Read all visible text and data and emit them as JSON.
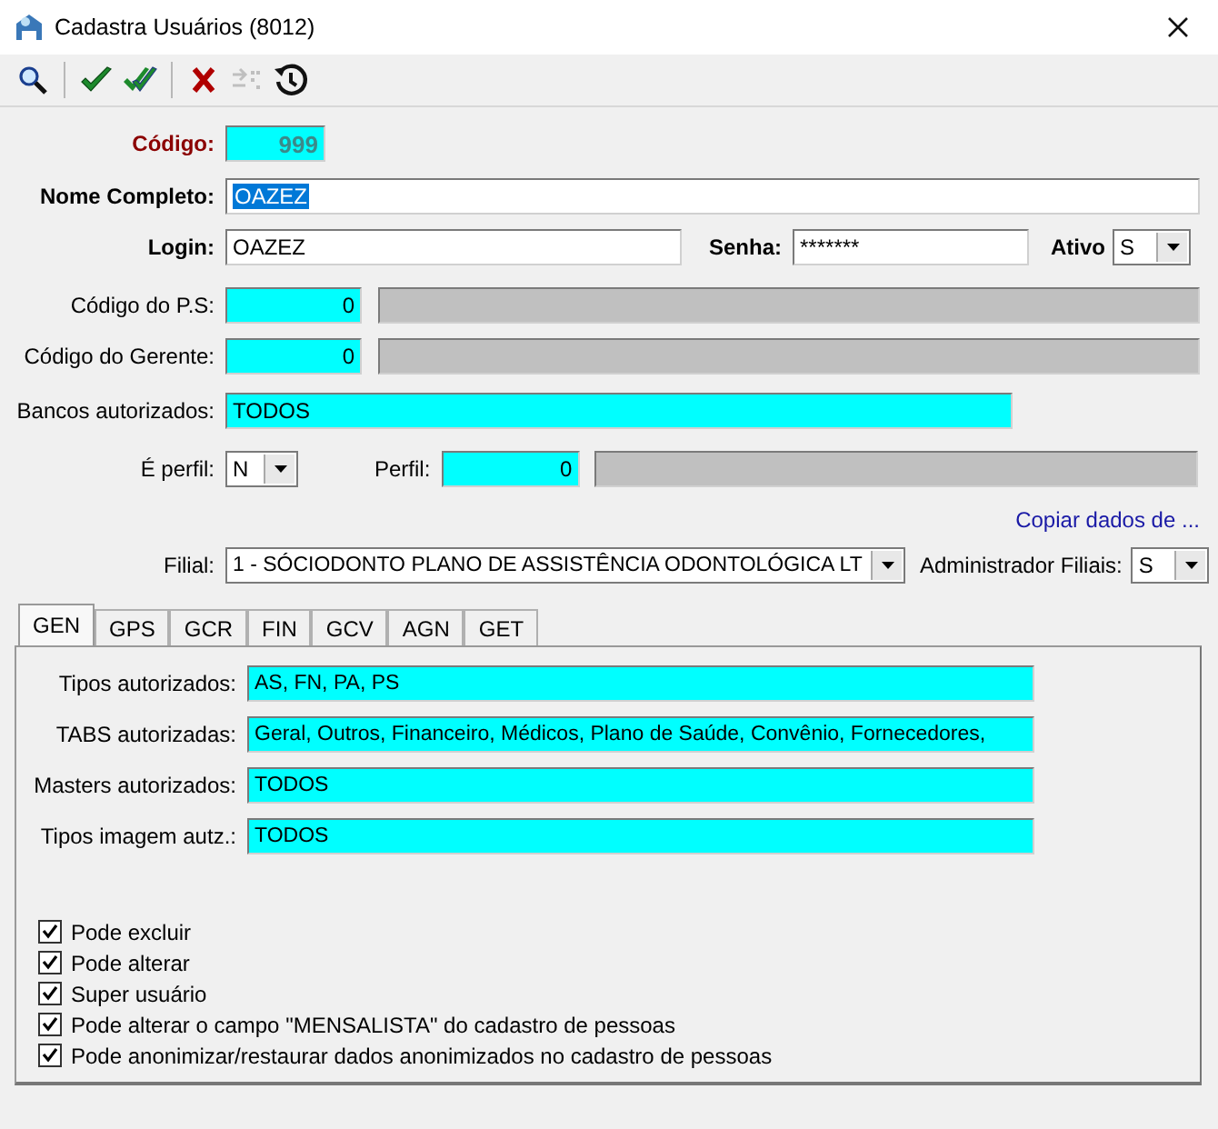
{
  "window": {
    "title": "Cadastra Usuários (8012)"
  },
  "toolbar": [
    [
      {
        "kind": "search",
        "disabled": false
      }
    ],
    [
      {
        "kind": "check",
        "disabled": false
      },
      {
        "kind": "double-check",
        "disabled": false
      }
    ],
    [
      {
        "kind": "cross",
        "disabled": false
      },
      {
        "kind": "transfer",
        "disabled": true
      },
      {
        "kind": "history",
        "disabled": false
      }
    ]
  ],
  "codigo": {
    "label": "Código:",
    "value": "999"
  },
  "nome_completo": {
    "label": "Nome Completo:",
    "value": "OAZEZ",
    "selected": true
  },
  "login": {
    "label": "Login:",
    "value": "OAZEZ"
  },
  "senha": {
    "label": "Senha:",
    "value": "*******"
  },
  "ativo": {
    "label": "Ativo",
    "value": "S"
  },
  "codigo_ps": {
    "label": "Código do P.S:",
    "value": "0"
  },
  "codigo_gerente": {
    "label": "Código do Gerente:",
    "value": "0"
  },
  "bancos_autorizados": {
    "label": "Bancos autorizados:",
    "value": "TODOS"
  },
  "e_perfil": {
    "label": "É perfil:",
    "value": "N"
  },
  "perfil": {
    "label": "Perfil:",
    "value": "0"
  },
  "copy_link": "Copiar dados de ...",
  "filial": {
    "label": "Filial:",
    "value": "1 - SÓCIODONTO PLANO DE ASSISTÊNCIA ODONTOLÓGICA LT"
  },
  "administrador_filiais": {
    "label": "Administrador Filiais:",
    "value": "S"
  },
  "tabs": [
    {
      "label": "GEN",
      "selected": true
    },
    {
      "label": "GPS",
      "selected": false
    },
    {
      "label": "GCR",
      "selected": false
    },
    {
      "label": "FIN",
      "selected": false
    },
    {
      "label": "GCV",
      "selected": false
    },
    {
      "label": "AGN",
      "selected": false
    },
    {
      "label": "GET",
      "selected": false
    }
  ],
  "gen_fields": [
    {
      "label": "Tipos autorizados:",
      "value": "AS, FN, PA, PS"
    },
    {
      "label": "TABS autorizadas:",
      "value": "Geral, Outros, Financeiro, Médicos, Plano de Saúde, Convênio, Fornecedores,"
    },
    {
      "label": "Masters autorizados:",
      "value": "TODOS"
    },
    {
      "label": "Tipos imagem autz.:",
      "value": "TODOS"
    }
  ],
  "permissions": [
    {
      "label": "Pode excluir",
      "checked": true
    },
    {
      "label": "Pode alterar",
      "checked": true
    },
    {
      "label": "Super usuário",
      "checked": true
    },
    {
      "label": "Pode alterar o campo \"MENSALISTA\" do cadastro de pessoas",
      "checked": true
    },
    {
      "label": "Pode anonimizar/restaurar dados anonimizados no cadastro de pessoas",
      "checked": true
    }
  ]
}
